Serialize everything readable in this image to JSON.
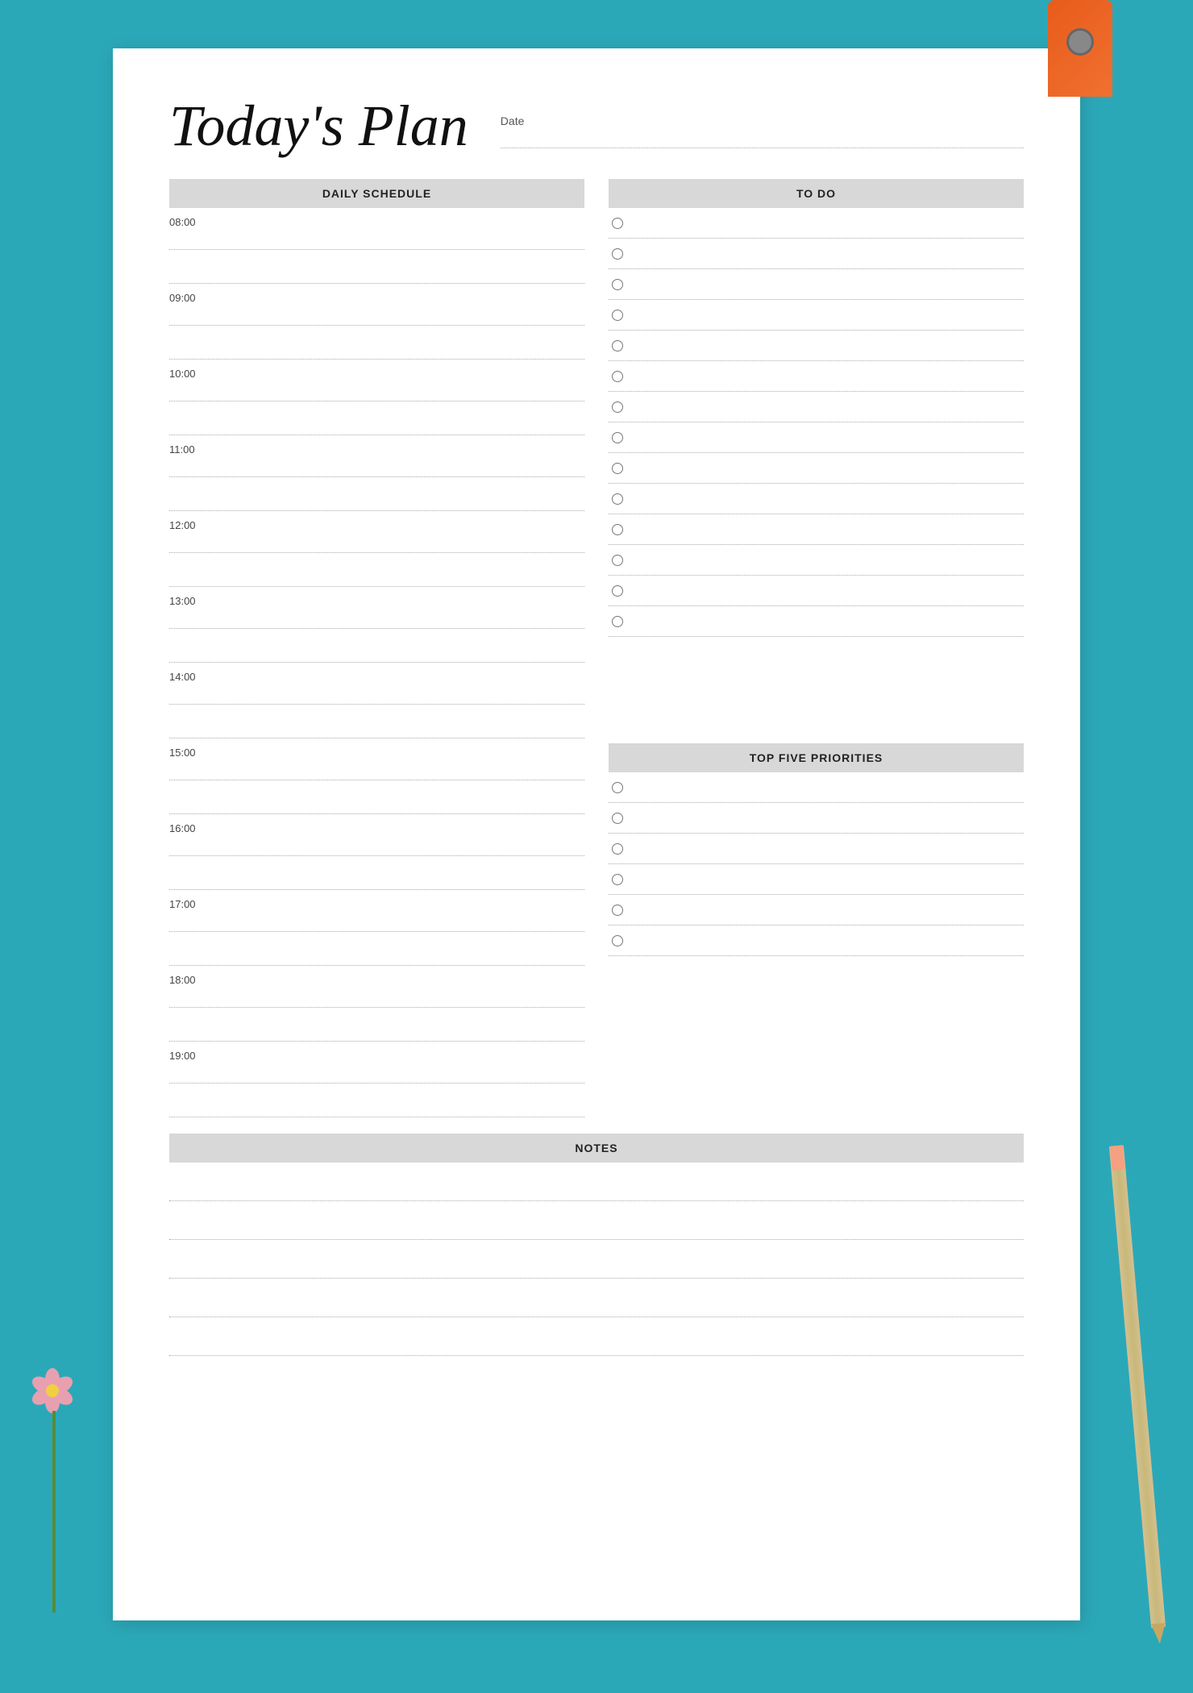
{
  "title": "Today's Plan",
  "date": {
    "label": "Date"
  },
  "daily_schedule": {
    "header": "DAILY SCHEDULE",
    "hours": [
      {
        "time": "08:00"
      },
      {
        "time": "09:00"
      },
      {
        "time": "10:00"
      },
      {
        "time": "11:00"
      },
      {
        "time": "12:00"
      },
      {
        "time": "13:00"
      },
      {
        "time": "14:00"
      },
      {
        "time": "15:00"
      },
      {
        "time": "16:00"
      },
      {
        "time": "17:00"
      },
      {
        "time": "18:00"
      },
      {
        "time": "19:00"
      }
    ]
  },
  "todo": {
    "header": "TO DO",
    "items_count": 14
  },
  "top_five": {
    "header": "TOP FIVE PRIORITIES",
    "items_count": 6
  },
  "notes": {
    "header": "NOTES",
    "lines_count": 5
  }
}
